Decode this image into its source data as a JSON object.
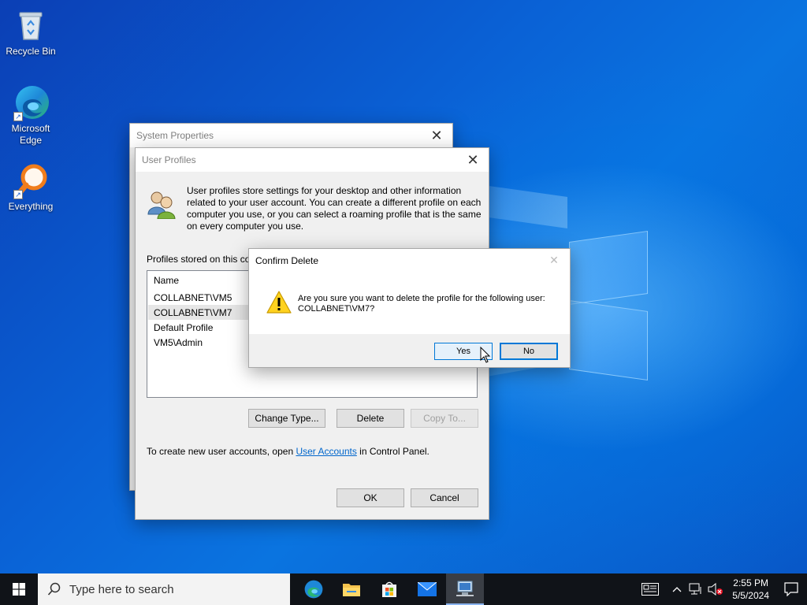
{
  "desktop": {
    "icons": [
      {
        "label": "Recycle Bin",
        "icon": "recycle-bin-icon"
      },
      {
        "label": "Microsoft Edge",
        "icon": "edge-icon"
      },
      {
        "label": "Everything",
        "icon": "everything-search-icon"
      }
    ]
  },
  "system_properties": {
    "title": "System Properties"
  },
  "user_profiles": {
    "title": "User Profiles",
    "description": "User profiles store settings for your desktop and other information related to your user account. You can create a different profile on each computer you use, or you can select a roaming profile that is the same on every computer you use.",
    "profiles_label": "Profiles stored on this co",
    "list_header": "Name",
    "profiles": [
      "COLLABNET\\VM5",
      "COLLABNET\\VM7",
      "Default Profile",
      "VM5\\Admin"
    ],
    "buttons": {
      "change_type": "Change Type...",
      "delete": "Delete",
      "copy_to": "Copy To..."
    },
    "footer_prefix": "To create new user accounts, open ",
    "footer_link": "User Accounts",
    "footer_suffix": " in Control Panel.",
    "ok": "OK",
    "cancel": "Cancel"
  },
  "confirm_delete": {
    "title": "Confirm Delete",
    "message": "Are you sure you want to delete the profile for the following user: COLLABNET\\VM7?",
    "yes": "Yes",
    "no": "No"
  },
  "taskbar": {
    "search_placeholder": "Type here to search",
    "time": "2:55 PM",
    "date": "5/5/2024"
  }
}
